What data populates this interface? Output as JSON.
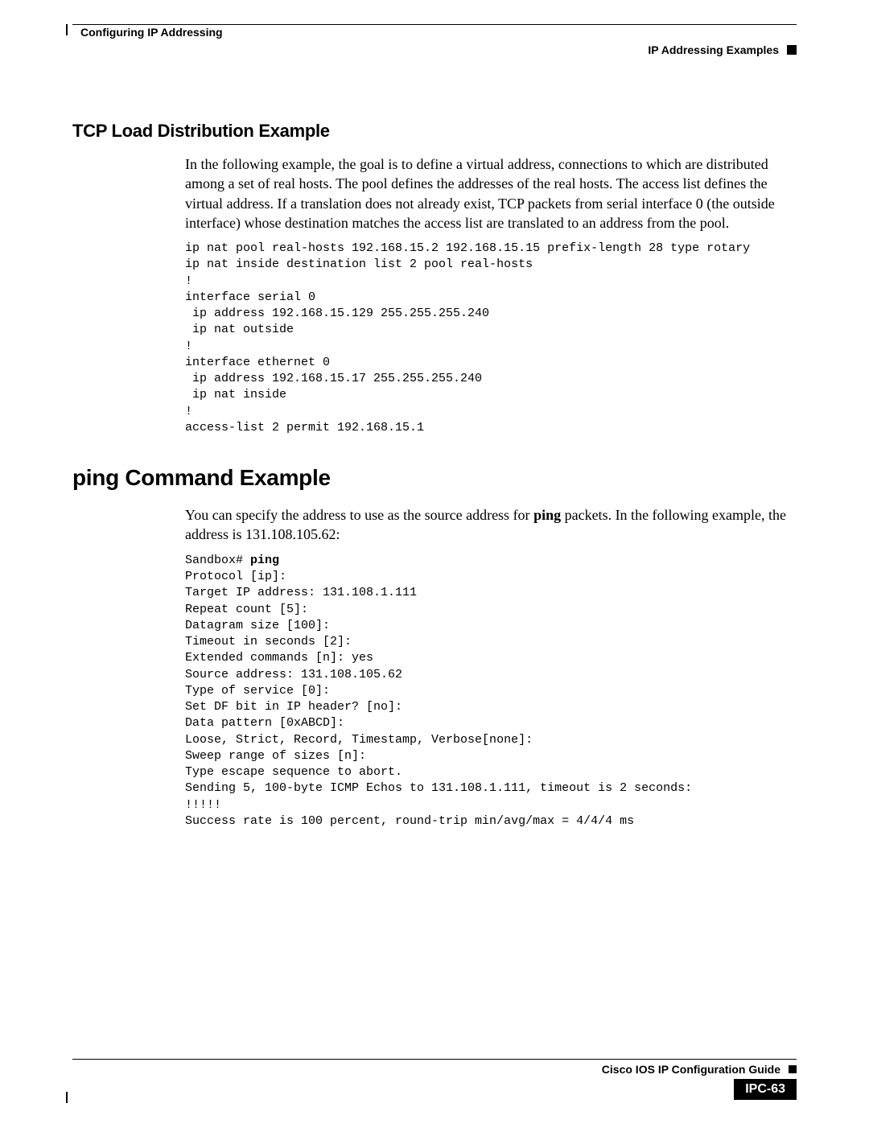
{
  "header": {
    "chapter": "Configuring IP Addressing",
    "section": "IP Addressing Examples"
  },
  "tcp": {
    "heading": "TCP Load Distribution Example",
    "paragraph": "In the following example, the goal is to define a virtual address, connections to which are distributed among a set of real hosts. The pool defines the addresses of the real hosts. The access list defines the virtual address. If a translation does not already exist, TCP packets from serial interface 0 (the outside interface) whose destination matches the access list are translated to an address from the pool.",
    "code": "ip nat pool real-hosts 192.168.15.2 192.168.15.15 prefix-length 28 type rotary\nip nat inside destination list 2 pool real-hosts\n!\ninterface serial 0\n ip address 192.168.15.129 255.255.255.240\n ip nat outside\n!\ninterface ethernet 0\n ip address 192.168.15.17 255.255.255.240\n ip nat inside\n!\naccess-list 2 permit 192.168.15.1"
  },
  "ping": {
    "heading": "ping Command Example",
    "para_before": "You can specify the address to use as the source address for ",
    "para_bold": "ping",
    "para_after": " packets. In the following example, the address is 131.108.105.62:",
    "prompt": "Sandbox# ",
    "cmd": "ping",
    "code_rest": "Protocol [ip]:\nTarget IP address: 131.108.1.111\nRepeat count [5]:\nDatagram size [100]:\nTimeout in seconds [2]:\nExtended commands [n]: yes\nSource address: 131.108.105.62\nType of service [0]:\nSet DF bit in IP header? [no]:\nData pattern [0xABCD]:\nLoose, Strict, Record, Timestamp, Verbose[none]:\nSweep range of sizes [n]:\nType escape sequence to abort.\nSending 5, 100-byte ICMP Echos to 131.108.1.111, timeout is 2 seconds:\n!!!!!\nSuccess rate is 100 percent, round-trip min/avg/max = 4/4/4 ms"
  },
  "footer": {
    "guide": "Cisco IOS IP Configuration Guide",
    "pagenum": "IPC-63"
  }
}
